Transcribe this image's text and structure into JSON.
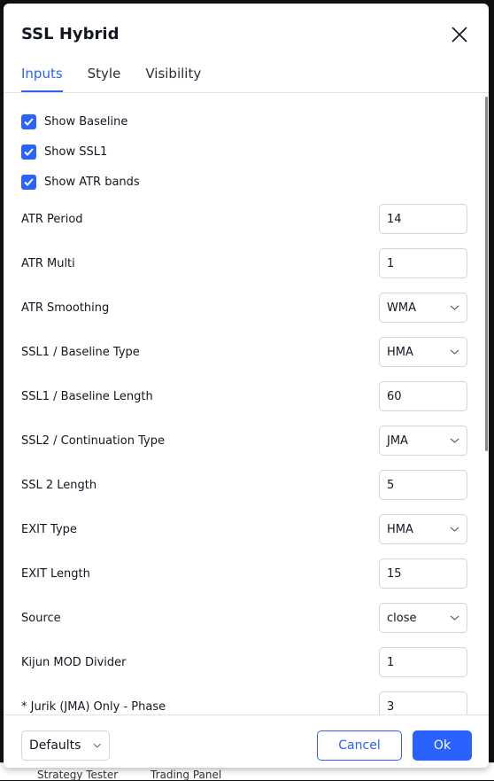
{
  "background": {
    "bottom_tabs": [
      "Strategy Tester",
      "Trading Panel"
    ]
  },
  "dialog": {
    "title": "SSL Hybrid",
    "tabs": [
      {
        "label": "Inputs",
        "active": true
      },
      {
        "label": "Style",
        "active": false
      },
      {
        "label": "Visibility",
        "active": false
      }
    ],
    "checkboxes": [
      {
        "label": "Show Baseline",
        "checked": true
      },
      {
        "label": "Show SSL1",
        "checked": true
      },
      {
        "label": "Show ATR bands",
        "checked": true
      }
    ],
    "fields": [
      {
        "label": "ATR Period",
        "value": "14",
        "type": "number"
      },
      {
        "label": "ATR Multi",
        "value": "1",
        "type": "number"
      },
      {
        "label": "ATR Smoothing",
        "value": "WMA",
        "type": "select"
      },
      {
        "label": "SSL1 / Baseline Type",
        "value": "HMA",
        "type": "select"
      },
      {
        "label": "SSL1 / Baseline Length",
        "value": "60",
        "type": "number"
      },
      {
        "label": "SSL2 / Continuation Type",
        "value": "JMA",
        "type": "select"
      },
      {
        "label": "SSL 2 Length",
        "value": "5",
        "type": "number"
      },
      {
        "label": "EXIT Type",
        "value": "HMA",
        "type": "select"
      },
      {
        "label": "EXIT Length",
        "value": "15",
        "type": "number"
      },
      {
        "label": "Source",
        "value": "close",
        "type": "select"
      },
      {
        "label": "Kijun MOD Divider",
        "value": "1",
        "type": "number"
      },
      {
        "label": "* Jurik (JMA) Only - Phase",
        "value": "3",
        "type": "number"
      }
    ],
    "footer": {
      "defaults": "Defaults",
      "cancel": "Cancel",
      "ok": "Ok"
    },
    "accent": "#2962ff"
  }
}
